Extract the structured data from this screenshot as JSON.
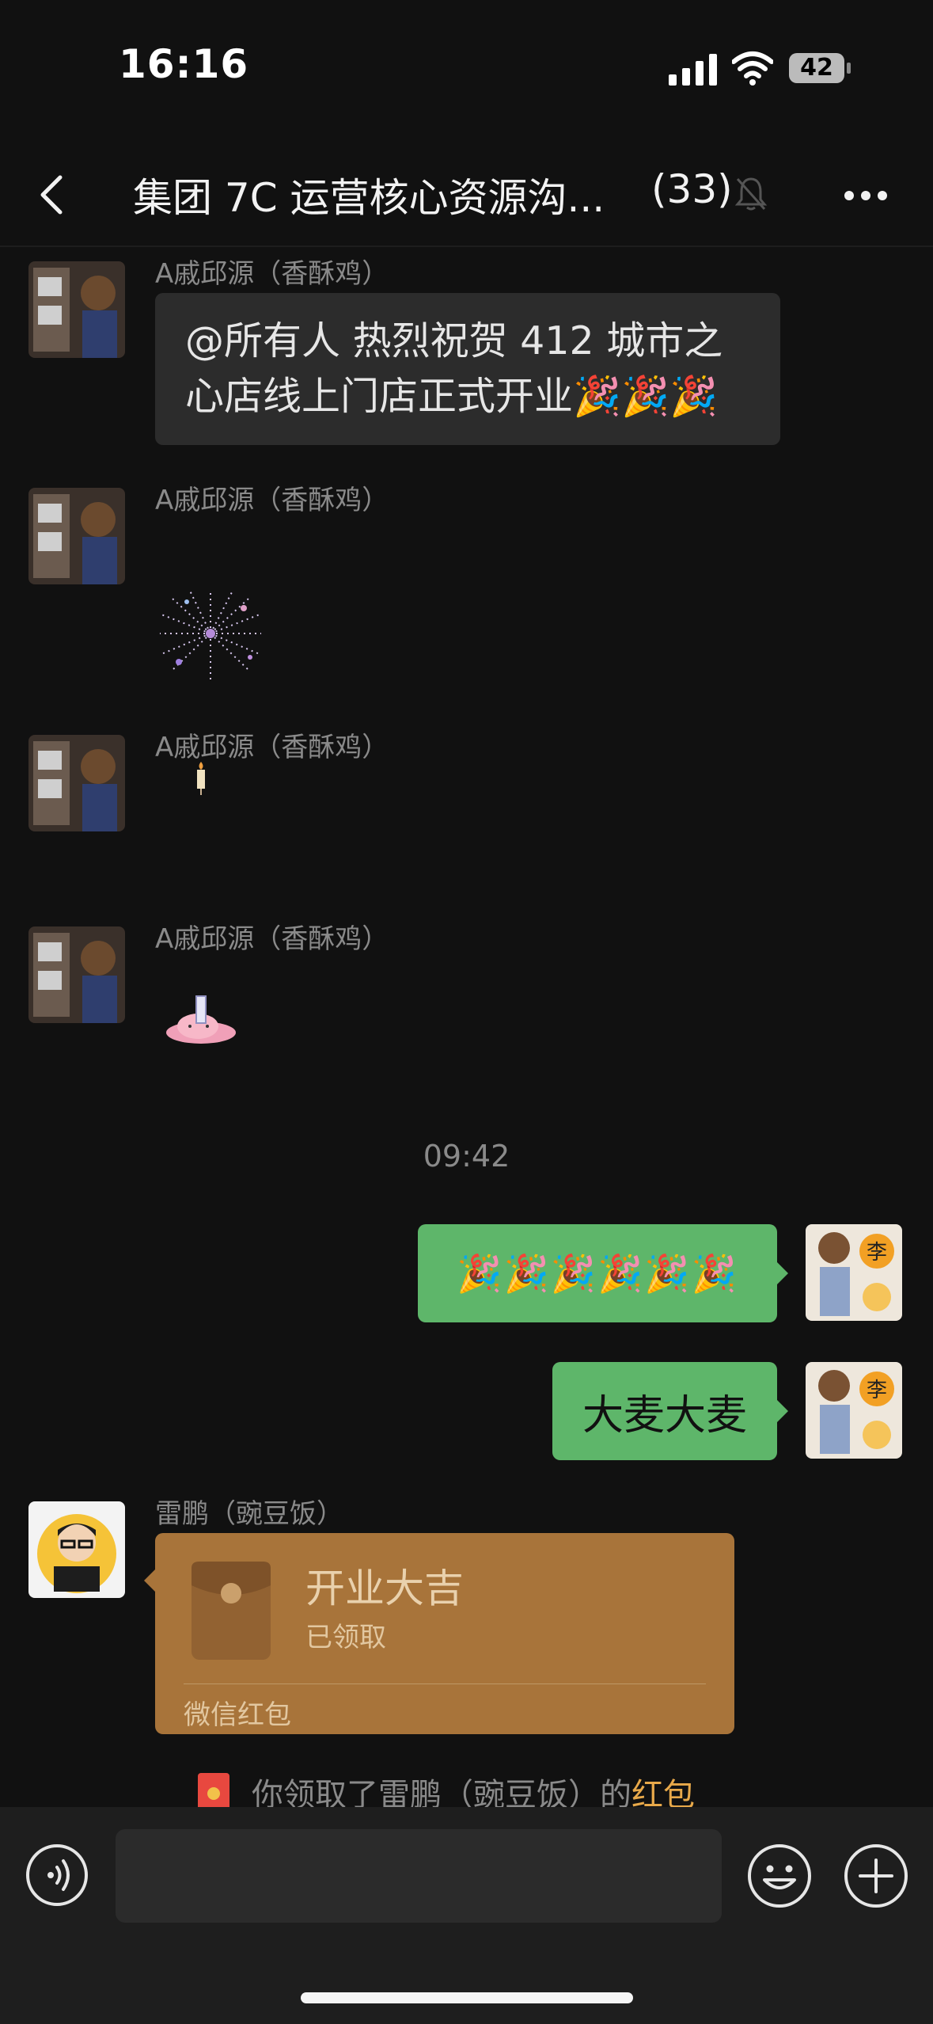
{
  "status_bar": {
    "time": "16:16",
    "battery": "42"
  },
  "header": {
    "title": "集团 7C 运营核心资源沟...",
    "member_count": "(33)"
  },
  "messages": [
    {
      "sender": "A戚邱源（香酥鸡）",
      "line1": "@所有人  热烈祝贺 412 城市之",
      "line2": "心店线上门店正式开业🎉🎉🎉"
    },
    {
      "sender": "A戚邱源（香酥鸡）",
      "sticker": "fireworks-sticker"
    },
    {
      "sender": "A戚邱源（香酥鸡）",
      "sticker": "candle-sticker"
    },
    {
      "sender": "A戚邱源（香酥鸡）",
      "sticker": "pink-character-sticker"
    }
  ],
  "timestamp": "09:42",
  "outgoing": [
    {
      "text": "🎉🎉🎉🎉🎉🎉"
    },
    {
      "text": "大麦大麦"
    }
  ],
  "red_packet": {
    "sender": "雷鹏（豌豆饭）",
    "title": "开业大吉",
    "status": "已领取",
    "brand": "微信红包"
  },
  "system_message": {
    "prefix": "你领取了雷鹏（豌豆饭）的",
    "link": "红包"
  },
  "colors": {
    "green_bubble": "#5eb66a",
    "red_packet": "#a8743a",
    "background": "#111111"
  }
}
